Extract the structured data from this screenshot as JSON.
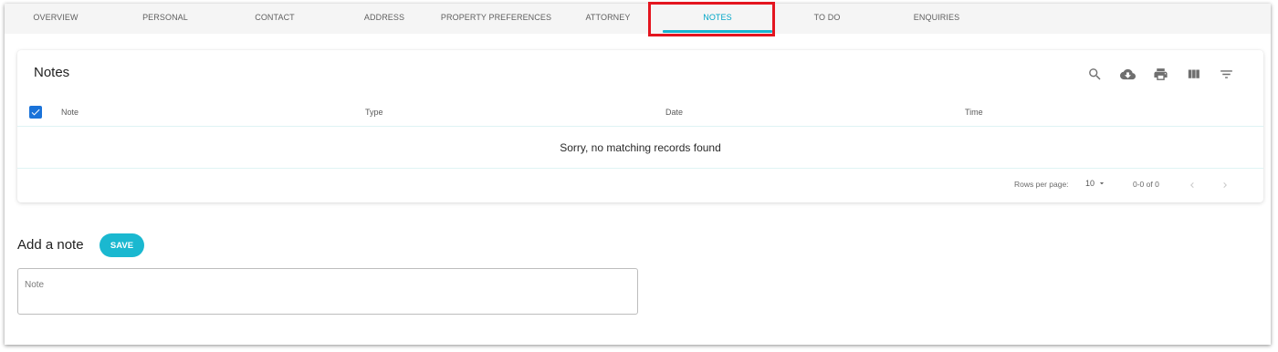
{
  "tabs": [
    {
      "label": "OVERVIEW",
      "active": false
    },
    {
      "label": "PERSONAL",
      "active": false
    },
    {
      "label": "CONTACT",
      "active": false
    },
    {
      "label": "ADDRESS",
      "active": false
    },
    {
      "label": "PROPERTY PREFERENCES",
      "active": false
    },
    {
      "label": "ATTORNEY",
      "active": false
    },
    {
      "label": "NOTES",
      "active": true
    },
    {
      "label": "TO DO",
      "active": false
    },
    {
      "label": "ENQUIRIES",
      "active": false
    }
  ],
  "notes_table": {
    "title": "Notes",
    "toolbar_icons": [
      "search-icon",
      "download-icon",
      "print-icon",
      "view-columns-icon",
      "filter-icon"
    ],
    "select_all_checked": true,
    "columns": [
      "Note",
      "Type",
      "Date",
      "Time"
    ],
    "empty_message": "Sorry, no matching records found",
    "pagination": {
      "rows_per_page_label": "Rows per page:",
      "rows_per_page_value": "10",
      "range_text": "0-0 of 0"
    }
  },
  "add_note": {
    "title": "Add a note",
    "save_label": "SAVE",
    "note_placeholder": "Note"
  },
  "colors": {
    "accent": "#18b4cf",
    "checkbox": "#1a73d9",
    "highlight": "#e4151f"
  }
}
